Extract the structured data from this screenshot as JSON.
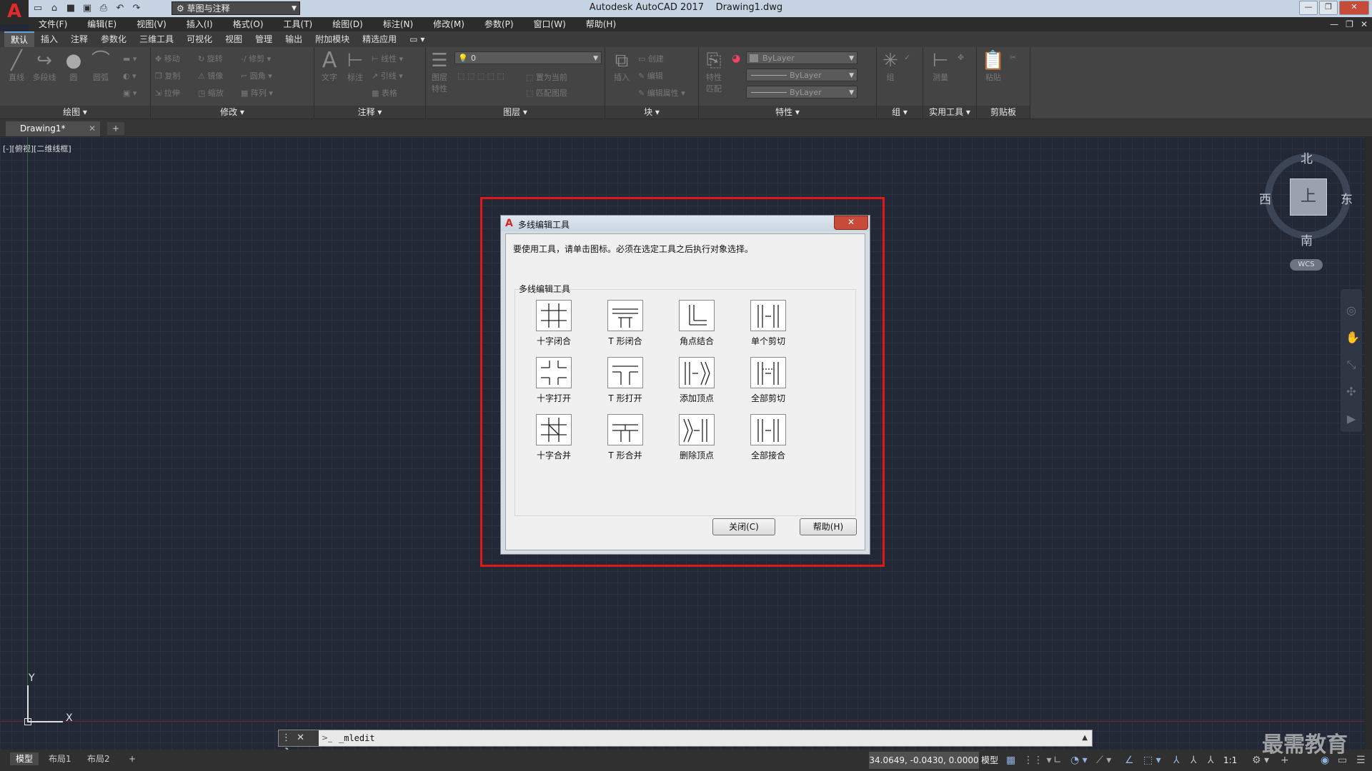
{
  "app": {
    "title": "Autodesk AutoCAD 2017",
    "file": "Drawing1.dwg",
    "logo": "A",
    "workspace": "草图与注释"
  },
  "menu": [
    "文件(F)",
    "编辑(E)",
    "视图(V)",
    "插入(I)",
    "格式(O)",
    "工具(T)",
    "绘图(D)",
    "标注(N)",
    "修改(M)",
    "参数(P)",
    "窗口(W)",
    "帮助(H)"
  ],
  "ribbon": {
    "tabs": [
      "默认",
      "插入",
      "注释",
      "参数化",
      "三维工具",
      "可视化",
      "视图",
      "管理",
      "输出",
      "附加模块",
      "精选应用"
    ],
    "active_tab": "默认",
    "panels": {
      "draw": {
        "title": "绘图 ▾",
        "line": "直线",
        "polyline": "多段线",
        "circle": "圆",
        "arc": "圆弧"
      },
      "modify": {
        "title": "修改 ▾",
        "move": "移动",
        "rotate": "旋转",
        "trim": "修剪",
        "copy": "复制",
        "mirror": "镜像",
        "fillet": "圆角",
        "stretch": "拉伸",
        "scale": "缩放",
        "array": "阵列"
      },
      "annotation": {
        "title": "注释 ▾",
        "text": "文字",
        "dimension": "标注",
        "linear": "线性",
        "leader": "引线",
        "table": "表格"
      },
      "layers": {
        "title": "图层 ▾",
        "layer_props": "图层特性",
        "current_layer": "0",
        "match_layer": "匹配图层",
        "set_current": "置为当前"
      },
      "block": {
        "title": "块 ▾",
        "insert": "插入",
        "create": "创建",
        "edit": "编辑",
        "edit_attr": "编辑属性"
      },
      "properties": {
        "title": "特性 ▾",
        "match": "特性匹配",
        "color": "ByLayer",
        "linetype": "ByLayer",
        "lineweight": "ByLayer"
      },
      "groups": {
        "title": "组 ▾",
        "group": "组"
      },
      "utilities": {
        "title": "实用工具 ▾",
        "measure": "测量"
      },
      "clipboard": {
        "title": "剪贴板",
        "paste": "粘贴"
      }
    }
  },
  "doc_tab": {
    "label": "Drawing1*",
    "close": "✕",
    "add": "+"
  },
  "viewport": {
    "label": "[-][俯视][二维线框]"
  },
  "viewcube": {
    "north": "北",
    "south": "南",
    "east": "东",
    "west": "西",
    "face": "上",
    "wcs": "WCS"
  },
  "ucs": {
    "x": "X",
    "y": "Y"
  },
  "dialog": {
    "title": "多线编辑工具",
    "close_x": "✕",
    "instruction": "要使用工具，请单击图标。必须在选定工具之后执行对象选择。",
    "group_label": "多线编辑工具",
    "tools": [
      "十字闭合",
      "T 形闭合",
      "角点结合",
      "单个剪切",
      "十字打开",
      "T 形打开",
      "添加顶点",
      "全部剪切",
      "十字合并",
      "T 形合并",
      "删除顶点",
      "全部接合"
    ],
    "close_button": "关闭(C)",
    "help_button": "帮助(H)"
  },
  "command": {
    "text": "_mledit",
    "prompt_icon": ">_"
  },
  "status": {
    "layouts": [
      "模型",
      "布局1",
      "布局2"
    ],
    "add_layout": "+",
    "coords": "34.0649, -0.0430, 0.0000",
    "model": "模型",
    "scale": "1:1"
  },
  "watermark": "最需教育"
}
